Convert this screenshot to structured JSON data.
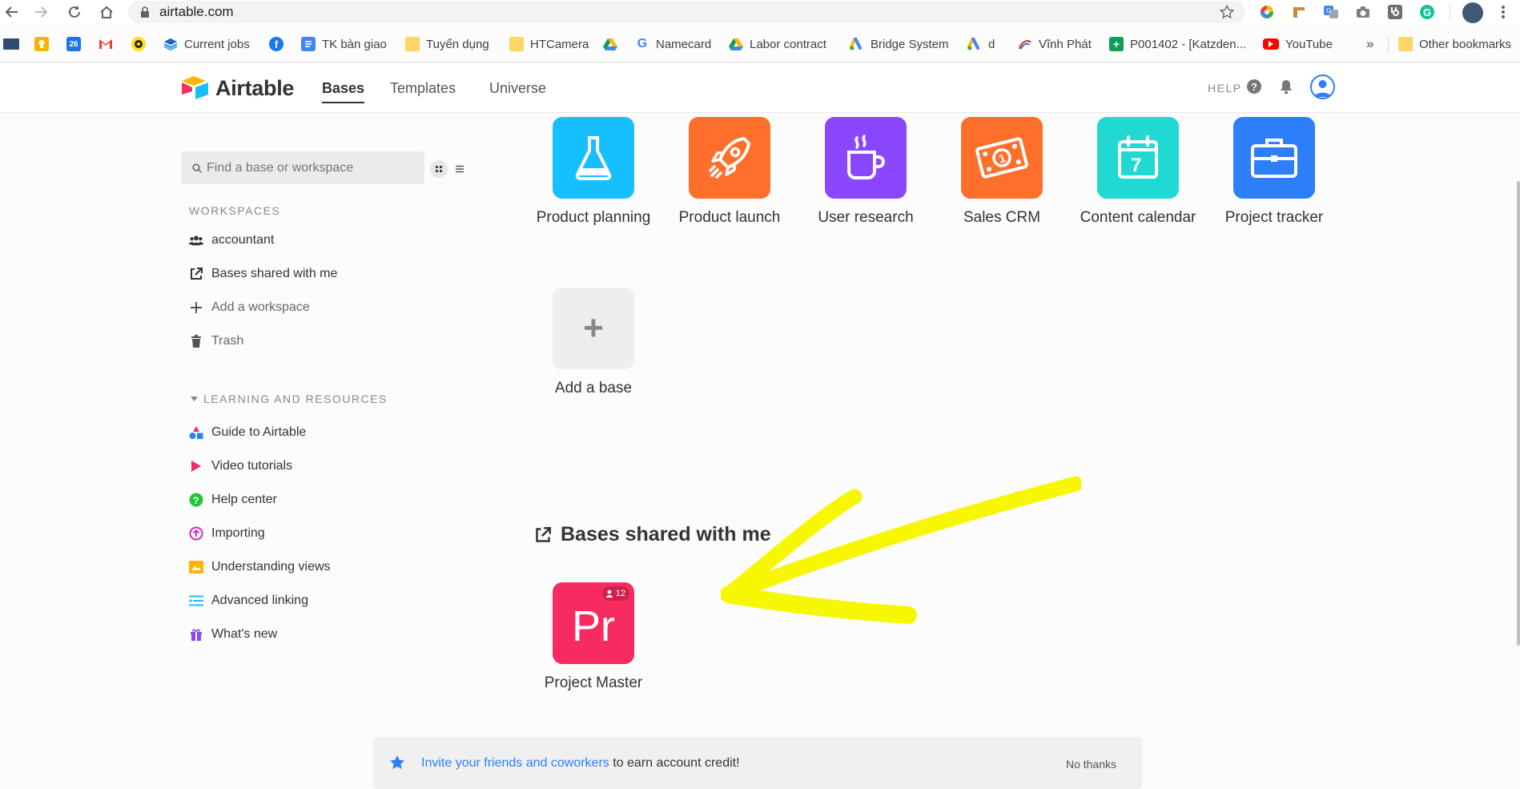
{
  "browser": {
    "url": "airtable.com",
    "bookmarks": [
      {
        "label": ""
      },
      {
        "label": ""
      },
      {
        "label": ""
      },
      {
        "label": ""
      },
      {
        "label": ""
      },
      {
        "label": "Current jobs"
      },
      {
        "label": ""
      },
      {
        "label": "TK bàn giao"
      },
      {
        "label": "Tuyển dụng"
      },
      {
        "label": "HTCamera"
      },
      {
        "label": ""
      },
      {
        "label": "Namecard"
      },
      {
        "label": "Labor contract"
      },
      {
        "label": "Bridge System"
      },
      {
        "label": "d"
      },
      {
        "label": "Vĩnh Phát"
      },
      {
        "label": "P001402 - [Katzden..."
      },
      {
        "label": "YouTube"
      },
      {
        "label": "»"
      },
      {
        "label": "Other bookmarks"
      }
    ],
    "calendar_day": "26"
  },
  "header": {
    "logo": "Airtable",
    "nav": [
      "Bases",
      "Templates",
      "Universe"
    ],
    "help": "HELP"
  },
  "sidebar": {
    "search_placeholder": "Find a base or workspace",
    "workspaces_label": "WORKSPACES",
    "workspaces": [
      {
        "label": "accountant",
        "icon": "users-icon"
      },
      {
        "label": "Bases shared with me",
        "icon": "share-icon"
      },
      {
        "label": "Add a workspace",
        "icon": "plus-icon"
      },
      {
        "label": "Trash",
        "icon": "trash-icon"
      }
    ],
    "learning_label": "LEARNING AND RESOURCES",
    "learning": [
      {
        "label": "Guide to Airtable",
        "icon": "shapes-icon"
      },
      {
        "label": "Video tutorials",
        "icon": "play-icon"
      },
      {
        "label": "Help center",
        "icon": "help-circle-icon"
      },
      {
        "label": "Importing",
        "icon": "upload-circle-icon"
      },
      {
        "label": "Understanding views",
        "icon": "views-icon"
      },
      {
        "label": "Advanced linking",
        "icon": "linking-icon"
      },
      {
        "label": "What's new",
        "icon": "gift-icon"
      }
    ]
  },
  "bases": [
    {
      "name": "Product planning",
      "color": "#18bfff",
      "icon": "flask-icon"
    },
    {
      "name": "Product launch",
      "color": "#ff6f2c",
      "icon": "rocket-icon"
    },
    {
      "name": "User research",
      "color": "#8b46ff",
      "icon": "coffee-icon"
    },
    {
      "name": "Sales CRM",
      "color": "#ff6f2c",
      "icon": "money-icon"
    },
    {
      "name": "Content calendar",
      "color": "#20d9d2",
      "icon": "calendar-icon"
    },
    {
      "name": "Project tracker",
      "color": "#2d7ff9",
      "icon": "briefcase-icon"
    }
  ],
  "calendar_icon_day": "7",
  "add_base": {
    "name": "Add a base",
    "symbol": "+"
  },
  "shared": {
    "title": "Bases shared with me",
    "bases": [
      {
        "name": "Project Master",
        "initials": "Pr",
        "color": "#f82b60",
        "collaborators": "12"
      }
    ]
  },
  "invite": {
    "link_text": "Invite your friends and coworkers",
    "rest_text": " to earn account credit!",
    "dismiss": "No thanks"
  }
}
